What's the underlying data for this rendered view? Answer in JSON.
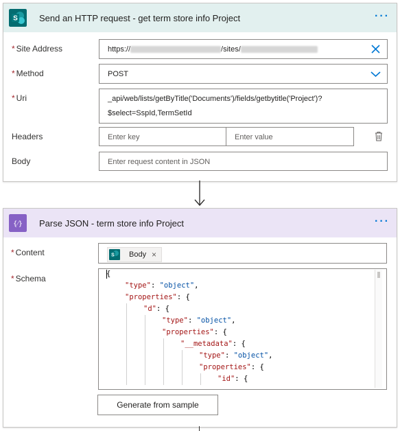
{
  "http_action": {
    "title": "Send an HTTP request - get term store info Project",
    "more": "···",
    "fields": {
      "site_address": {
        "label": "Site Address",
        "prefix": "https://",
        "middle": "/sites/"
      },
      "method": {
        "label": "Method",
        "value": "POST"
      },
      "uri": {
        "label": "Uri",
        "line1": "_api/web/lists/getByTitle('Documents')/fields/getbytitle('Project')?",
        "line2": "$select=SspId,TermSetId"
      },
      "headers": {
        "label": "Headers",
        "key_placeholder": "Enter key",
        "value_placeholder": "Enter value"
      },
      "body": {
        "label": "Body",
        "placeholder": "Enter request content in JSON"
      }
    }
  },
  "parse_action": {
    "title": "Parse JSON - term store info Project",
    "more": "···",
    "content": {
      "label": "Content",
      "token": "Body",
      "token_remove": "×"
    },
    "schema": {
      "label": "Schema",
      "lines": [
        {
          "indent": 0,
          "text": "{"
        },
        {
          "indent": 1,
          "key": "\"type\"",
          "sep": ": ",
          "val": "\"object\"",
          "end": ","
        },
        {
          "indent": 1,
          "key": "\"properties\"",
          "sep": ": ",
          "val": "",
          "end": "{"
        },
        {
          "indent": 2,
          "key": "\"d\"",
          "sep": ": ",
          "val": "",
          "end": "{"
        },
        {
          "indent": 3,
          "key": "\"type\"",
          "sep": ": ",
          "val": "\"object\"",
          "end": ","
        },
        {
          "indent": 3,
          "key": "\"properties\"",
          "sep": ": ",
          "val": "",
          "end": "{"
        },
        {
          "indent": 4,
          "key": "\"__metadata\"",
          "sep": ": ",
          "val": "",
          "end": "{"
        },
        {
          "indent": 5,
          "key": "\"type\"",
          "sep": ": ",
          "val": "\"object\"",
          "end": ","
        },
        {
          "indent": 5,
          "key": "\"properties\"",
          "sep": ": ",
          "val": "",
          "end": "{"
        },
        {
          "indent": 6,
          "key": "\"id\"",
          "sep": ": ",
          "val": "",
          "end": "{"
        }
      ]
    },
    "generate_button": "Generate from sample"
  },
  "icons": {
    "sharepoint": "sharepoint-icon",
    "parse_json": "parse-json-icon",
    "clear": "clear-x-icon",
    "chevron": "chevron-down-icon",
    "delete": "delete-icon",
    "arrow": "down-arrow-icon"
  },
  "colors": {
    "sharepoint_teal": "#036c70",
    "parse_purple": "#8661c5",
    "accent_blue": "#0078d4",
    "required_red": "#a4262c"
  }
}
